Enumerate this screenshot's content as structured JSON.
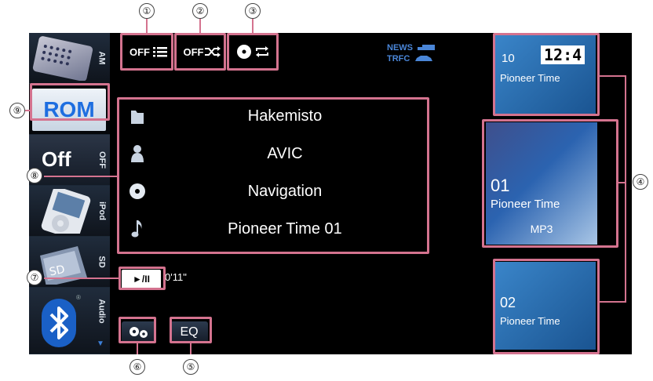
{
  "sources": [
    {
      "label": "AM",
      "thumb": "radio"
    },
    {
      "label": "ROM",
      "thumb": "rom"
    },
    {
      "label": "OFF",
      "thumb": "off",
      "text": "Off"
    },
    {
      "label": "iPod",
      "thumb": "ipod"
    },
    {
      "label": "SD",
      "thumb": "sd"
    },
    {
      "label": "Audio",
      "thumb": "bluetooth"
    }
  ],
  "top_buttons": {
    "repeat_list_label": "OFF",
    "shuffle_label": "OFF",
    "repeat_icon": "repeat-disc-icon"
  },
  "traffic": {
    "news": "NEWS",
    "trfc": "TRFC"
  },
  "info_rows": [
    {
      "icon": "folder-icon",
      "text": "Hakemisto"
    },
    {
      "icon": "artist-icon",
      "text": "AVIC"
    },
    {
      "icon": "disc-icon",
      "text": "Navigation"
    },
    {
      "icon": "note-icon",
      "text": "Pioneer Time 01"
    }
  ],
  "playback": {
    "play_pause": "►/II",
    "elapsed": "0'11\""
  },
  "bottom": {
    "eq_label": "EQ",
    "settings_icon": "gear-icon"
  },
  "tracks": {
    "prev": {
      "number": "10",
      "name": "Pioneer Time"
    },
    "current": {
      "number": "01",
      "name": "Pioneer Time",
      "format": "MP3"
    },
    "next": {
      "number": "02",
      "name": "Pioneer Time"
    }
  },
  "clock": "12:4",
  "callouts": [
    "①",
    "②",
    "③",
    "④",
    "⑤",
    "⑥",
    "⑦",
    "⑧",
    "⑨"
  ],
  "colors": {
    "highlight": "#d4738f",
    "rom_blue": "#1e6ee0",
    "tile_blue": "#2a82c8"
  }
}
